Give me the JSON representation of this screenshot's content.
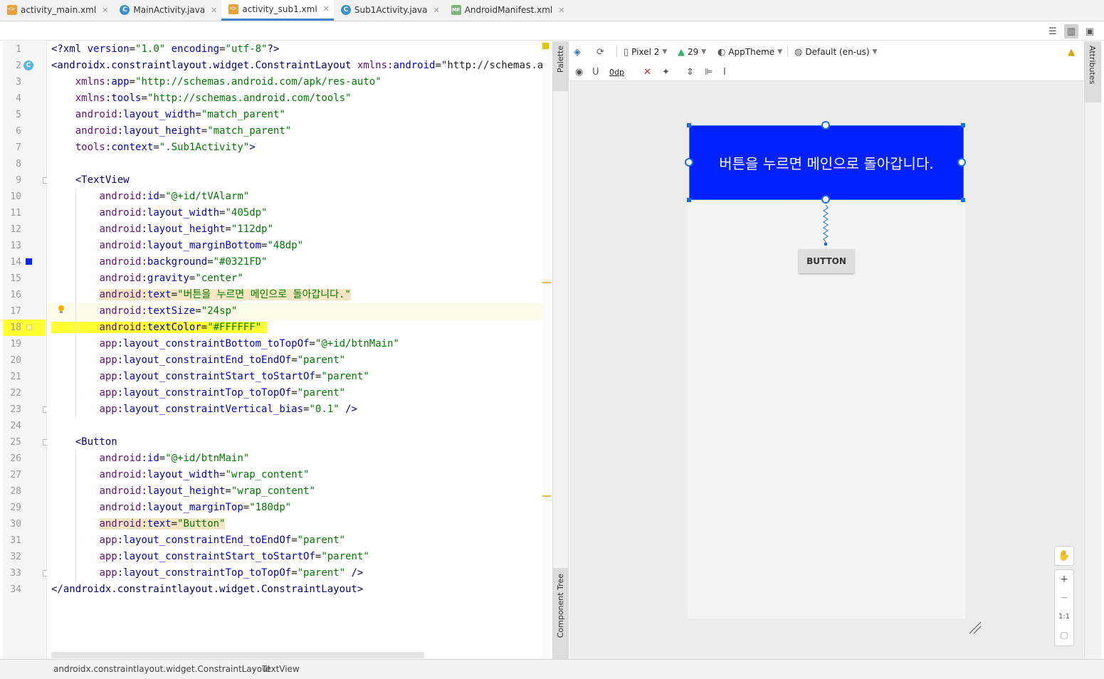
{
  "tabs": [
    {
      "label": "activity_main.xml",
      "type": "xml",
      "active": false
    },
    {
      "label": "MainActivity.java",
      "type": "java",
      "active": false
    },
    {
      "label": "activity_sub1.xml",
      "type": "xml",
      "active": true
    },
    {
      "label": "Sub1Activity.java",
      "type": "java",
      "active": false
    },
    {
      "label": "AndroidManifest.xml",
      "type": "mf",
      "active": false
    }
  ],
  "editor": {
    "line_numbers": [
      "1",
      "2",
      "3",
      "4",
      "5",
      "6",
      "7",
      "8",
      "9",
      "10",
      "11",
      "12",
      "13",
      "14",
      "15",
      "16",
      "17",
      "18",
      "19",
      "20",
      "21",
      "22",
      "23",
      "24",
      "25",
      "26",
      "27",
      "28",
      "29",
      "30",
      "31",
      "32",
      "33",
      "34"
    ],
    "lines": [
      "<?xml version=\"1.0\" encoding=\"utf-8\"?>",
      "<androidx.constraintlayout.widget.ConstraintLayout xmlns:android=\"http://schemas.android",
      "    xmlns:app=\"http://schemas.android.com/apk/res-auto\"",
      "    xmlns:tools=\"http://schemas.android.com/tools\"",
      "    android:layout_width=\"match_parent\"",
      "    android:layout_height=\"match_parent\"",
      "    tools:context=\".Sub1Activity\">",
      "",
      "    <TextView",
      "        android:id=\"@+id/tVAlarm\"",
      "        android:layout_width=\"405dp\"",
      "        android:layout_height=\"112dp\"",
      "        android:layout_marginBottom=\"48dp\"",
      "        android:background=\"#0321FD\"",
      "        android:gravity=\"center\"",
      "        android:text=\"버튼을 누르면 메인으로 돌아갑니다.\"",
      "        android:textSize=\"24sp\"",
      "        android:textColor=\"#FFFFFF\"",
      "        app:layout_constraintBottom_toTopOf=\"@+id/btnMain\"",
      "        app:layout_constraintEnd_toEndOf=\"parent\"",
      "        app:layout_constraintStart_toStartOf=\"parent\"",
      "        app:layout_constraintTop_toTopOf=\"parent\"",
      "        app:layout_constraintVertical_bias=\"0.1\" />",
      "",
      "    <Button",
      "        android:id=\"@+id/btnMain\"",
      "        android:layout_width=\"wrap_content\"",
      "        android:layout_height=\"wrap_content\"",
      "        android:layout_marginTop=\"180dp\"",
      "        android:text=\"Button\"",
      "        app:layout_constraintEnd_toEndOf=\"parent\"",
      "        app:layout_constraintStart_toStartOf=\"parent\"",
      "        app:layout_constraintTop_toTopOf=\"parent\" />",
      "</androidx.constraintlayout.widget.ConstraintLayout>"
    ]
  },
  "side_panels": {
    "palette": "Palette",
    "component_tree": "Component Tree",
    "attributes": "Attributes"
  },
  "design_toolbar": {
    "device": "Pixel 2",
    "api": "29",
    "theme": "AppTheme",
    "locale": "Default (en-us)",
    "margin": "0dp"
  },
  "preview": {
    "textview_text": "버튼을 누르면 메인으로 돌아갑니다.",
    "textview_bg": "#0321FD",
    "textview_color": "#FFFFFF",
    "button_text": "BUTTON"
  },
  "zoom": {
    "plus": "+",
    "minus": "−",
    "one_to_one": "1:1"
  },
  "breadcrumb": [
    "androidx.constraintlayout.widget.ConstraintLayout",
    "TextView"
  ]
}
